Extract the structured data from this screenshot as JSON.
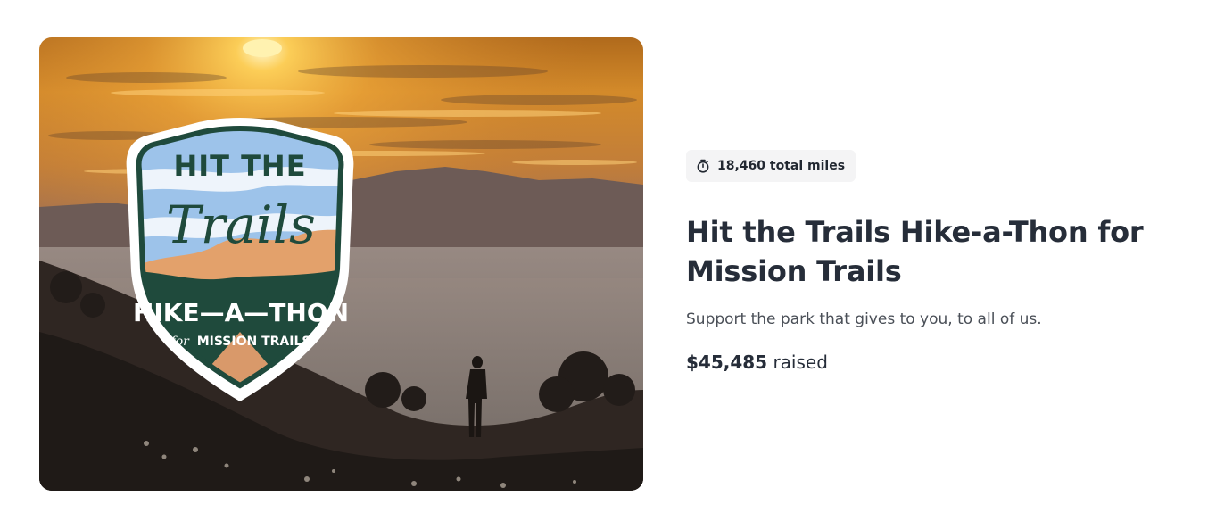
{
  "campaign": {
    "image_alt": "Hit the Trails Hike-a-Thon badge over a sunset trail view",
    "badge": {
      "line1": "HIT THE",
      "line2": "Trails",
      "line3": "HIKE—A—THON",
      "line4_prefix": "for",
      "line4": "MISSION TRAILS"
    },
    "stat": {
      "icon": "stopwatch-icon",
      "text": "18,460 total miles"
    },
    "title": "Hit the Trails Hike-a-Thon for Mission Trails",
    "description": "Support the park that gives to you, to all of us.",
    "raised": {
      "amount": "$45,485",
      "suffix": "raised"
    }
  },
  "colors": {
    "badge_green": "#1f4a3c",
    "badge_orange": "#e3a16b",
    "badge_sky": "#9dc3ea",
    "text_dark": "#262d39",
    "pill_bg": "#f4f4f5"
  }
}
